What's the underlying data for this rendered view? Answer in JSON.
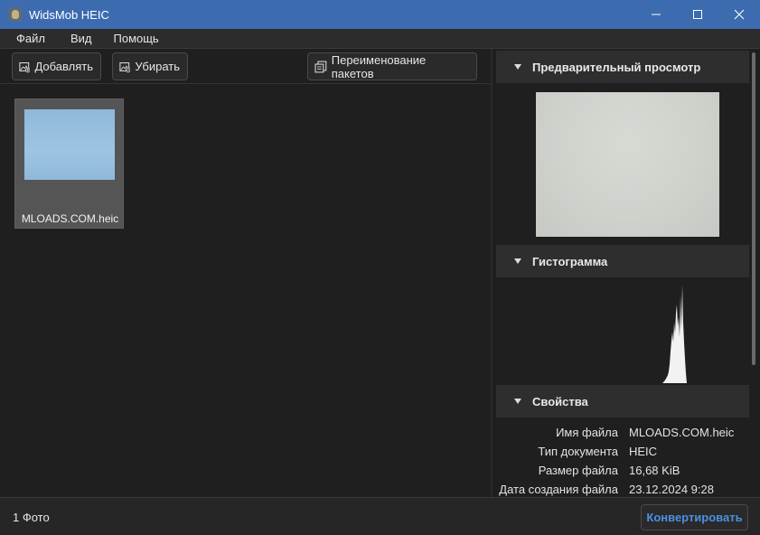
{
  "window": {
    "title": "WidsMob HEIC",
    "title_bar_color": "#3d6bb0",
    "controls": [
      "minimize-icon",
      "maximize-icon",
      "close-icon"
    ]
  },
  "menu": {
    "items": [
      {
        "label": "Файл"
      },
      {
        "label": "Вид"
      },
      {
        "label": "Помощь"
      }
    ]
  },
  "toolbar": {
    "add_label": "Добавлять",
    "add_icon": "add-image-icon",
    "remove_label": "Убирать",
    "remove_icon": "remove-image-icon",
    "rename_label": "Переименование пакетов",
    "rename_icon": "copy-files-icon"
  },
  "gallery": {
    "items": [
      {
        "filename": "MLOADS.COM.heic",
        "selected": true
      }
    ]
  },
  "panels": {
    "preview_title": "Предварительный просмотр",
    "histogram_title": "Гистограмма",
    "properties_title": "Свойства"
  },
  "properties": {
    "rows": [
      {
        "key": "Имя файла",
        "value": "MLOADS.COM.heic"
      },
      {
        "key": "Тип документа",
        "value": "HEIC"
      },
      {
        "key": "Размер файла",
        "value": "16,68 KiB"
      },
      {
        "key": "Дата создания файла",
        "value": "23.12.2024 9:28"
      }
    ]
  },
  "status": {
    "count_text": "1 Фото",
    "convert_label": "Конвертировать",
    "accent_color": "#4a90e2"
  }
}
